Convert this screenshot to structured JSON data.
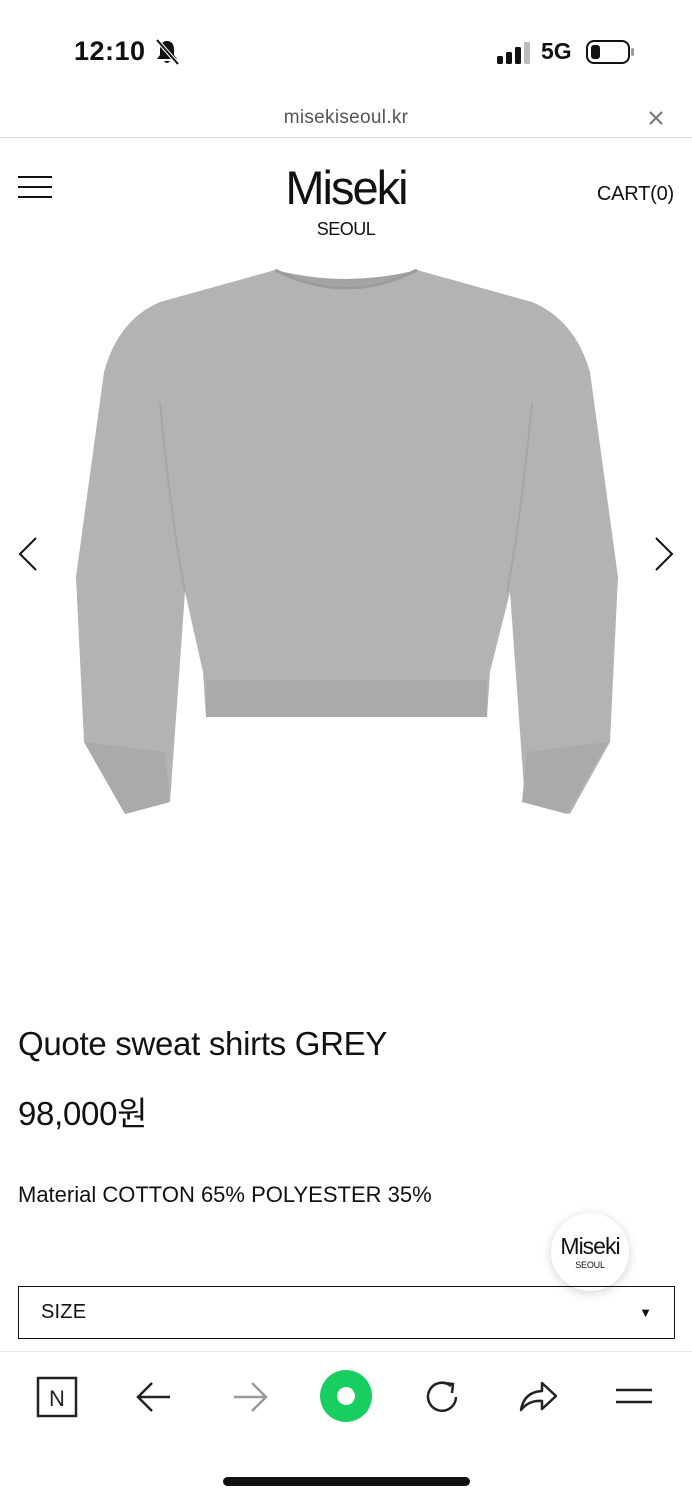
{
  "status_bar": {
    "time": "12:10",
    "mute_icon": "bell-slash-icon",
    "signal_icon": "cellular-signal-icon",
    "network": "5G",
    "battery_icon": "battery-low-icon",
    "battery_level": 0.2
  },
  "url_bar": {
    "url": "misekiseoul.kr",
    "close_icon": "close-icon"
  },
  "header": {
    "menu_icon": "hamburger-menu-icon",
    "logo_main": "Miseki",
    "logo_sub": "SEOUL",
    "cart_label": "CART(0)"
  },
  "product": {
    "image_icon": "grey-sweatshirt-back-image",
    "name": "Quote sweat shirts GREY",
    "price": "98,000원",
    "material": "Material COTTON 65% POLYESTER 35%",
    "size_select": {
      "label": "SIZE",
      "caret": "▼"
    },
    "sweatshirt_color": "#b5b5b5"
  },
  "floating_badge": {
    "main": "Miseki",
    "sub": "SEOUL"
  },
  "toolbar": {
    "items": [
      "naver-n-icon",
      "back-arrow-icon",
      "forward-arrow-icon",
      "green-circle-home-icon",
      "refresh-icon",
      "share-icon",
      "menu-icon"
    ],
    "naver_letter": "N",
    "accent_color": "#19ce60"
  }
}
